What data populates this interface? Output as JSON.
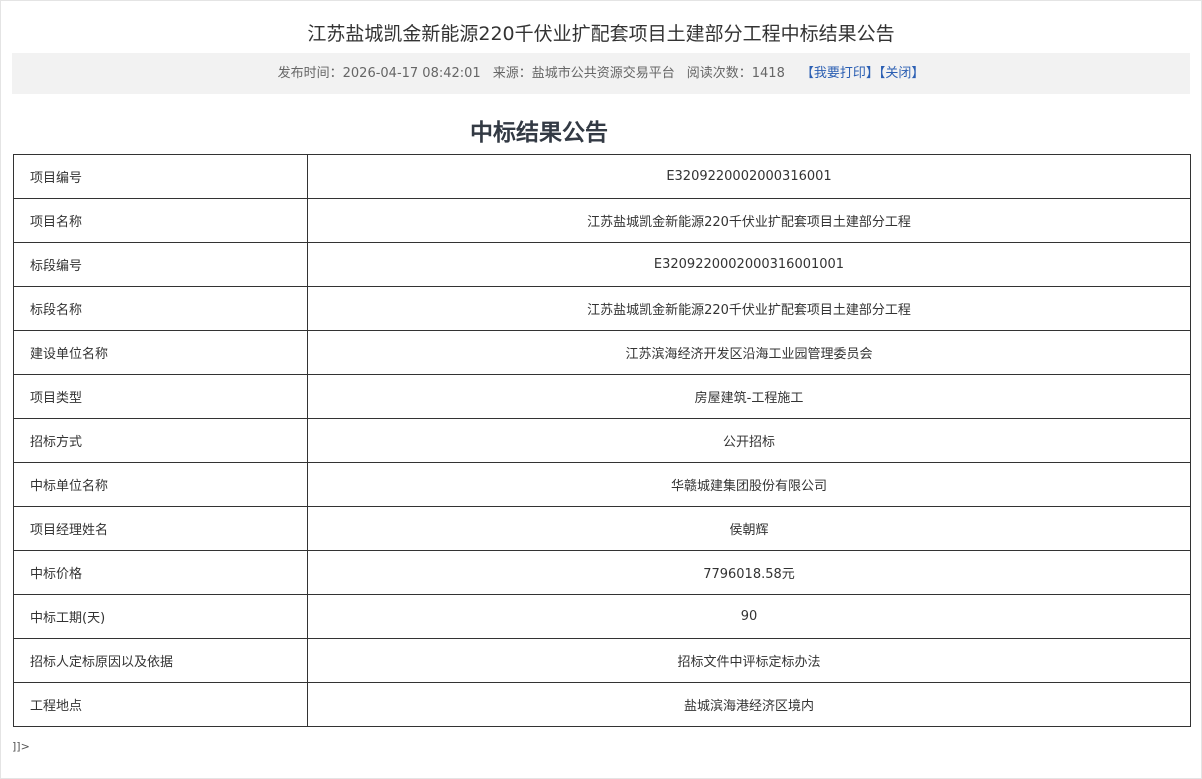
{
  "page": {
    "title": "江苏盐城凯金新能源220千伏业扩配套项目土建部分工程中标结果公告"
  },
  "info": {
    "publish_label": "发布时间：",
    "publish_time": "2026-04-17 08:42:01",
    "source_label": "来源：",
    "source": "盐城市公共资源交易平台",
    "views_label": "阅读次数：",
    "views": "1418",
    "print_link": "【我要打印】",
    "close_link": "【关闭】"
  },
  "document": {
    "heading": "中标结果公告",
    "rows": [
      {
        "label": "项目编号",
        "value": "E3209220002000316001"
      },
      {
        "label": "项目名称",
        "value": "江苏盐城凯金新能源220千伏业扩配套项目土建部分工程"
      },
      {
        "label": "标段编号",
        "value": "E3209220002000316001001"
      },
      {
        "label": "标段名称",
        "value": "江苏盐城凯金新能源220千伏业扩配套项目土建部分工程"
      },
      {
        "label": "建设单位名称",
        "value": "江苏滨海经济开发区沿海工业园管理委员会"
      },
      {
        "label": "项目类型",
        "value": "房屋建筑-工程施工"
      },
      {
        "label": "招标方式",
        "value": "公开招标"
      },
      {
        "label": "中标单位名称",
        "value": "华赣城建集团股份有限公司"
      },
      {
        "label": "项目经理姓名",
        "value": "侯朝辉"
      },
      {
        "label": "中标价格",
        "value": "7796018.58元"
      },
      {
        "label": "中标工期(天)",
        "value": "90"
      },
      {
        "label": "招标人定标原因以及依据",
        "value": "招标文件中评标定标办法"
      },
      {
        "label": "工程地点",
        "value": "盐城滨海港经济区境内"
      }
    ],
    "trailer": "]]>"
  }
}
